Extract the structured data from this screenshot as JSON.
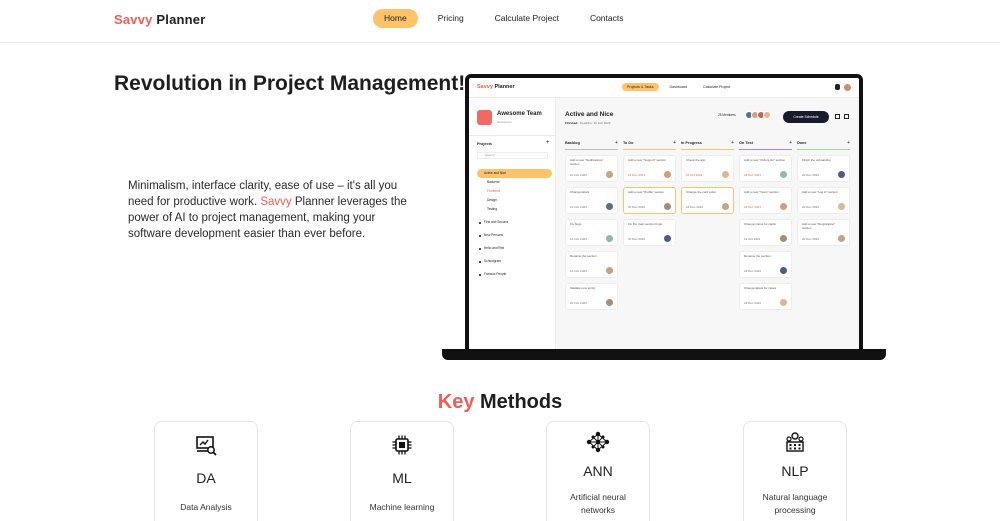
{
  "brand": {
    "part1": "Savvy",
    "part2": "Planner"
  },
  "nav": [
    {
      "label": "Home",
      "active": true
    },
    {
      "label": "Pricing",
      "active": false
    },
    {
      "label": "Calculate Project",
      "active": false
    },
    {
      "label": "Contacts",
      "active": false
    }
  ],
  "hero": {
    "title": "Revolution in Project Management!",
    "text_before": "Minimalism, interface clarity, ease of use – it's all you need for productive work. ",
    "text_accent": "Savvy",
    "text_after": " Planner leverages the power of AI to project management, making your software development easier than ever before."
  },
  "app": {
    "brand_part1": "Savvy",
    "brand_part2": "Planner",
    "nav": [
      "Projects & Tasks",
      "Dashboard",
      "Calculate Project"
    ],
    "team_name": "Awesome Team",
    "team_sub": "Workspace",
    "projects_label": "Projects",
    "search_placeholder": "Search",
    "sidebar": [
      {
        "label": "Active and Nice",
        "kind": "active"
      },
      {
        "label": "Backend",
        "kind": "sub"
      },
      {
        "label": "Frontend",
        "kind": "sub-hl"
      },
      {
        "label": "Design",
        "kind": "sub"
      },
      {
        "label": "Testing",
        "kind": "sub"
      },
      {
        "label": "First and Second",
        "kind": "group"
      },
      {
        "label": "New Persons",
        "kind": "group"
      },
      {
        "label": "Hello and Red",
        "kind": "group"
      },
      {
        "label": "Schoolgram",
        "kind": "group"
      },
      {
        "label": "Famous People",
        "kind": "group"
      }
    ],
    "board_title": "Active and Nice",
    "board_status": "Finished",
    "board_deadline": "Deadline: 30 Feb 2024",
    "members": "25 Members",
    "create_button": "Create Schedule",
    "columns": [
      {
        "name": "Backlog",
        "color": "#bdbdbd",
        "cards": [
          {
            "text": "Add a new \"Notifications\" section",
            "date": "10 Feb 2023",
            "red": false,
            "hl": false
          },
          {
            "text": "Change labels",
            "date": "12 Feb 2023",
            "red": false,
            "hl": false
          },
          {
            "text": "Fix bugs",
            "date": "14 Feb 2023",
            "red": false,
            "hl": false
          },
          {
            "text": "Rename the section",
            "date": "14 Feb 2023",
            "red": false,
            "hl": false
          },
          {
            "text": "Validate new sprint",
            "date": "20 Feb 2023",
            "red": false,
            "hl": false
          }
        ]
      },
      {
        "name": "To Do",
        "color": "#fdc36b",
        "cards": [
          {
            "text": "Add a new \"Support\" section",
            "date": "24 Dec 2021",
            "red": true,
            "hl": false
          },
          {
            "text": "Add a new \"Profile\" section",
            "date": "20 Dec 2022",
            "red": false,
            "hl": true
          },
          {
            "text": "Fix the main section bugs",
            "date": "20 Dec 2022",
            "red": false,
            "hl": false
          }
        ]
      },
      {
        "name": "In Progress",
        "color": "#fdc36b",
        "cards": [
          {
            "text": "Check the app",
            "date": "10 Oct 2022",
            "red": true,
            "hl": false
          },
          {
            "text": "Change the card order",
            "date": "24 Dec 2022",
            "red": false,
            "hl": true
          }
        ]
      },
      {
        "name": "On Test",
        "color": "#a58bd9",
        "cards": [
          {
            "text": "Add a new \"Orders list\" section",
            "date": "24 Dec 2021",
            "red": true,
            "hl": false
          },
          {
            "text": "Add a new \"Team\" section",
            "date": "24 Dec 2021",
            "red": true,
            "hl": false
          },
          {
            "text": "Change colors for cards",
            "date": "12 Oct 2022",
            "red": false,
            "hl": false
          },
          {
            "text": "Rename the section",
            "date": "24 Dec 2022",
            "red": false,
            "hl": false
          },
          {
            "text": "Change labels for cases",
            "date": "24 Dec 2022",
            "red": false,
            "hl": false
          }
        ]
      },
      {
        "name": "Done",
        "color": "#9ed6a0",
        "cards": [
          {
            "text": "Finish the onboarding",
            "date": "20 Dec 2022",
            "red": false,
            "hl": false
          },
          {
            "text": "Add a new \"Log in\" section",
            "date": "20 Dec 2022",
            "red": false,
            "hl": false
          },
          {
            "text": "Add a new \"Registration\" section",
            "date": "20 Dec 2022",
            "red": false,
            "hl": false
          }
        ]
      }
    ]
  },
  "methods": {
    "title_accent": "Key",
    "title_rest": " Methods",
    "cards": [
      {
        "abbr": "DA",
        "desc": "Data Analysis",
        "icon": "data-analysis-icon"
      },
      {
        "abbr": "ML",
        "desc": "Machine learning",
        "icon": "chip-icon"
      },
      {
        "abbr": "ANN",
        "desc": "Artificial neural networks",
        "icon": "neural-network-icon"
      },
      {
        "abbr": "NLP",
        "desc": "Natural language processing",
        "icon": "language-processing-icon"
      }
    ]
  },
  "colors": {
    "accent": "#ef5d55",
    "highlight": "#fdc36b",
    "dark": "#1e1e1e"
  }
}
